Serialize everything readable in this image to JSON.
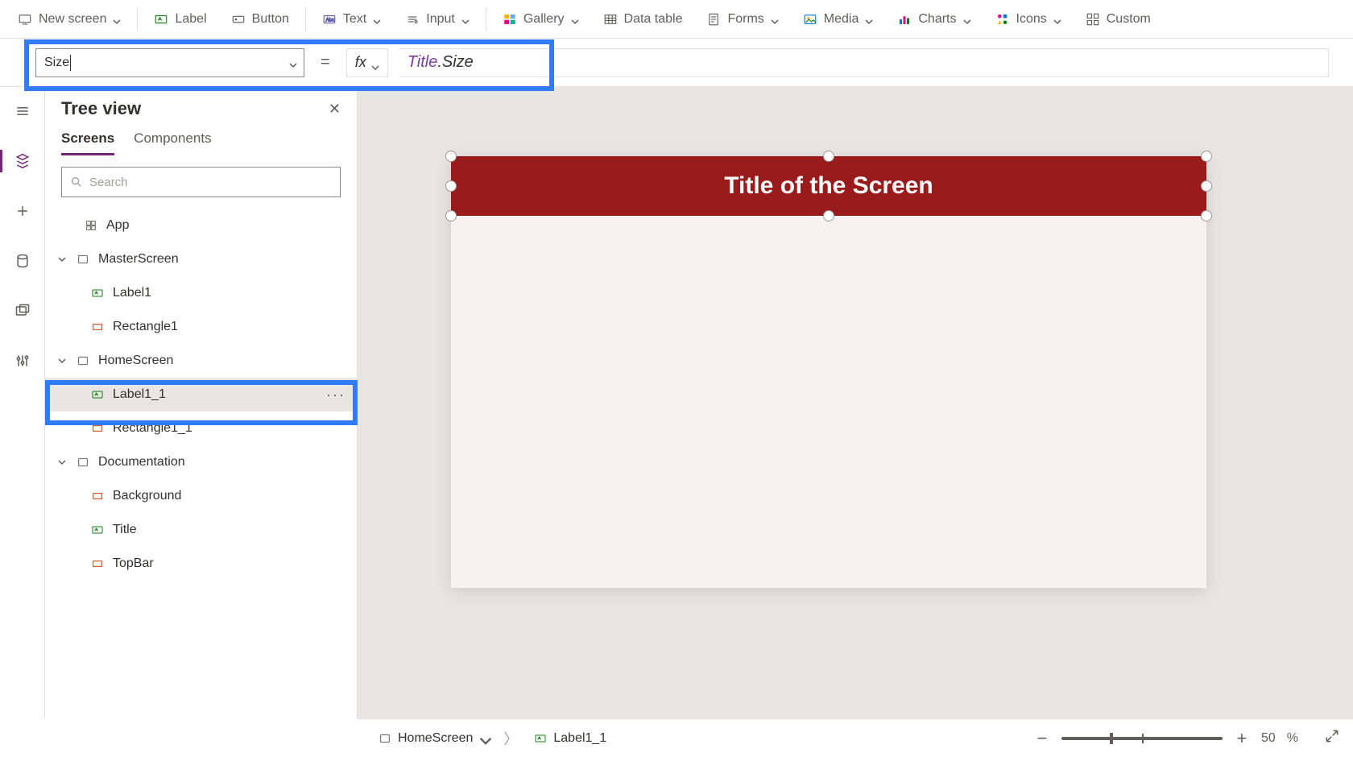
{
  "ribbon": {
    "new_screen": "New screen",
    "label": "Label",
    "button": "Button",
    "text": "Text",
    "input": "Input",
    "gallery": "Gallery",
    "data_table": "Data table",
    "forms": "Forms",
    "media": "Media",
    "charts": "Charts",
    "icons": "Icons",
    "custom": "Custom"
  },
  "formula": {
    "property": "Size",
    "eq": "=",
    "fx": "fx",
    "expr_obj": "Title",
    "expr_dot": ".",
    "expr_prop": "Size"
  },
  "tree": {
    "title": "Tree view",
    "tab_screens": "Screens",
    "tab_components": "Components",
    "search_placeholder": "Search",
    "app": "App",
    "master": "MasterScreen",
    "master_label": "Label1",
    "master_rect": "Rectangle1",
    "home": "HomeScreen",
    "home_label": "Label1_1",
    "home_rect": "Rectangle1_1",
    "doc": "Documentation",
    "doc_bg": "Background",
    "doc_title": "Title",
    "doc_topbar": "TopBar",
    "more": "···"
  },
  "canvas": {
    "title_text": "Title of the Screen"
  },
  "status": {
    "crumb_screen": "HomeScreen",
    "crumb_control": "Label1_1",
    "zoom_pct": "50",
    "zoom_unit": "%"
  }
}
